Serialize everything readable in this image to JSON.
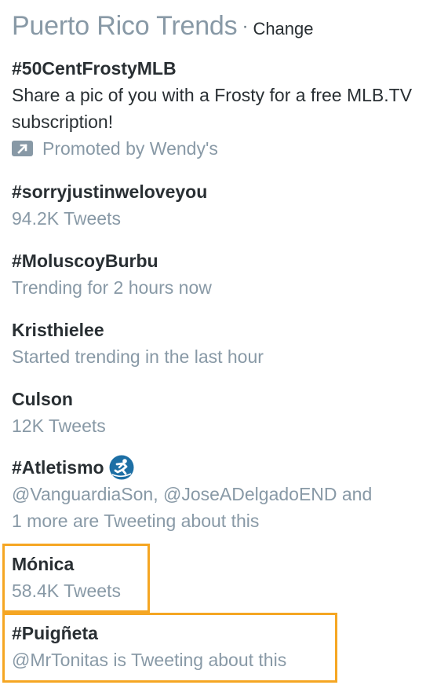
{
  "header": {
    "title": "Puerto Rico Trends",
    "separator": "·",
    "change_label": "Change"
  },
  "trends": [
    {
      "name": "#50CentFrostyMLB",
      "description": "Share a pic of you with a Frosty for a free MLB.TV subscription!",
      "promoted_label": "Promoted by Wendy's",
      "icon": "promoted-arrow-icon"
    },
    {
      "name": "#sorryjustinweloveyou",
      "meta": "94.2K Tweets"
    },
    {
      "name": "#MoluscoyBurbu",
      "meta": "Trending for 2 hours now"
    },
    {
      "name": "Kristhielee",
      "meta": "Started trending in the last hour"
    },
    {
      "name": "Culson",
      "meta": "12K Tweets"
    },
    {
      "name": "#Atletismo",
      "meta_line1": "@VanguardiaSon, @JoseADelgadoEND and",
      "meta_line2": "1 more are Tweeting about this",
      "icon": "runner-hashflag-icon"
    },
    {
      "name": "Mónica",
      "meta": "58.4K Tweets"
    },
    {
      "name": "#Puigñeta",
      "meta": "@MrTonitas is Tweeting about this"
    }
  ],
  "colors": {
    "highlight": "#f5a623",
    "muted": "#8899a6",
    "text": "#292f33"
  }
}
